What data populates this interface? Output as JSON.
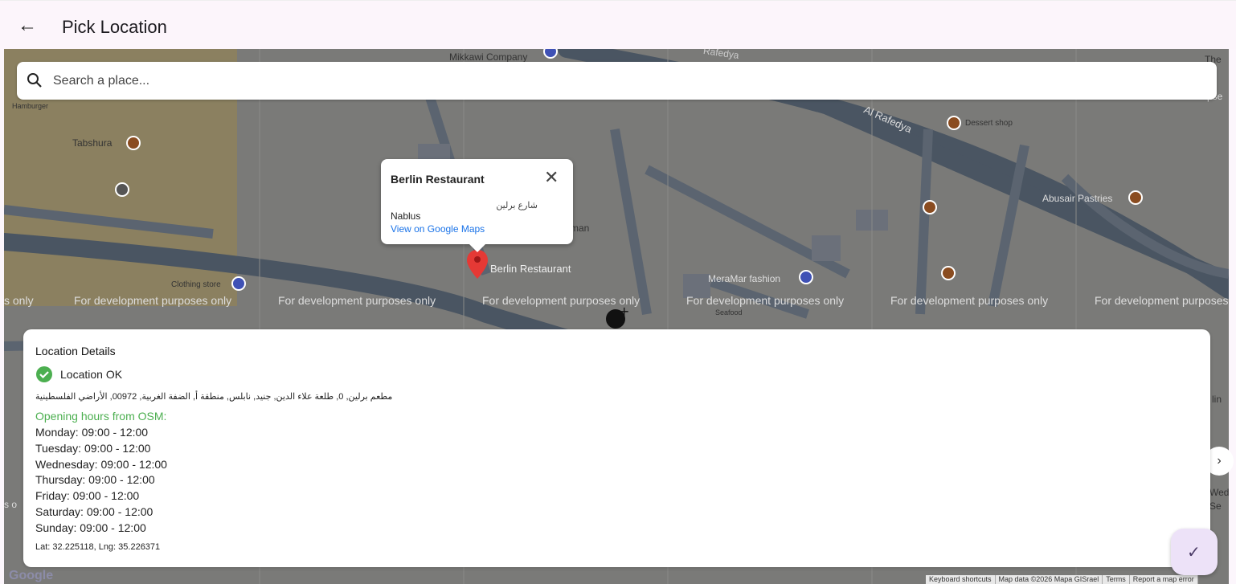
{
  "appbar": {
    "title": "Pick Location",
    "back_icon": "arrow-left-icon"
  },
  "search": {
    "placeholder": "Search a place..."
  },
  "info_window": {
    "name": "Berlin Restaurant",
    "address_ar": "شارع برلين",
    "city": "Nablus",
    "link": "View on Google Maps"
  },
  "map": {
    "labels": {
      "mikkawi": "Mikkawi Company",
      "rafedya_top": "Rafedya",
      "al_rafedya": "Al Rafedya",
      "hamburger": "Hamburger",
      "tabshura": "Tabshura",
      "dessert": "Dessert shop",
      "abusair": "Abusair Pastries",
      "clothing": "Clothing store",
      "marker": "Berlin Restaurant",
      "meramar": "MeraMar fashion",
      "seafood": "Seafood",
      "man": "man",
      "the": "The",
      "lin": "lin",
      "wed": "Wed",
      "se": "Se",
      "pse": "pse",
      "ses_o": "s o"
    },
    "dev_text": [
      "s only",
      "For development purposes only",
      "For development purposes only",
      "For development purposes only",
      "For development purposes only",
      "For development purposes only",
      "For development purposes only"
    ],
    "logo": "Google",
    "footer": [
      "Keyboard shortcuts",
      "Map data ©2026 Mapa GISrael",
      "Terms",
      "Report a map error"
    ]
  },
  "details": {
    "heading": "Location Details",
    "status": "Location OK",
    "address": "مطعم برلين, 0, طلعة علاء الدين, جنيد, نابلس, منطقة أ, الضفة الغربية, 00972, الأراضي الفلسطينية",
    "hours_title": "Opening hours from OSM:",
    "hours": [
      "Monday: 09:00 - 12:00",
      "Tuesday: 09:00 - 12:00",
      "Wednesday: 09:00 - 12:00",
      "Thursday: 09:00 - 12:00",
      "Friday: 09:00 - 12:00",
      "Saturday: 09:00 - 12:00",
      "Sunday: 09:00 - 12:00"
    ],
    "latlng": "Lat: 32.225118, Lng: 35.226371"
  },
  "fab": {
    "icon": "check-icon"
  },
  "colors": {
    "accent": "#4caf50",
    "link": "#1a73e8",
    "marker": "#e53935",
    "fab": "#ede2f8"
  }
}
